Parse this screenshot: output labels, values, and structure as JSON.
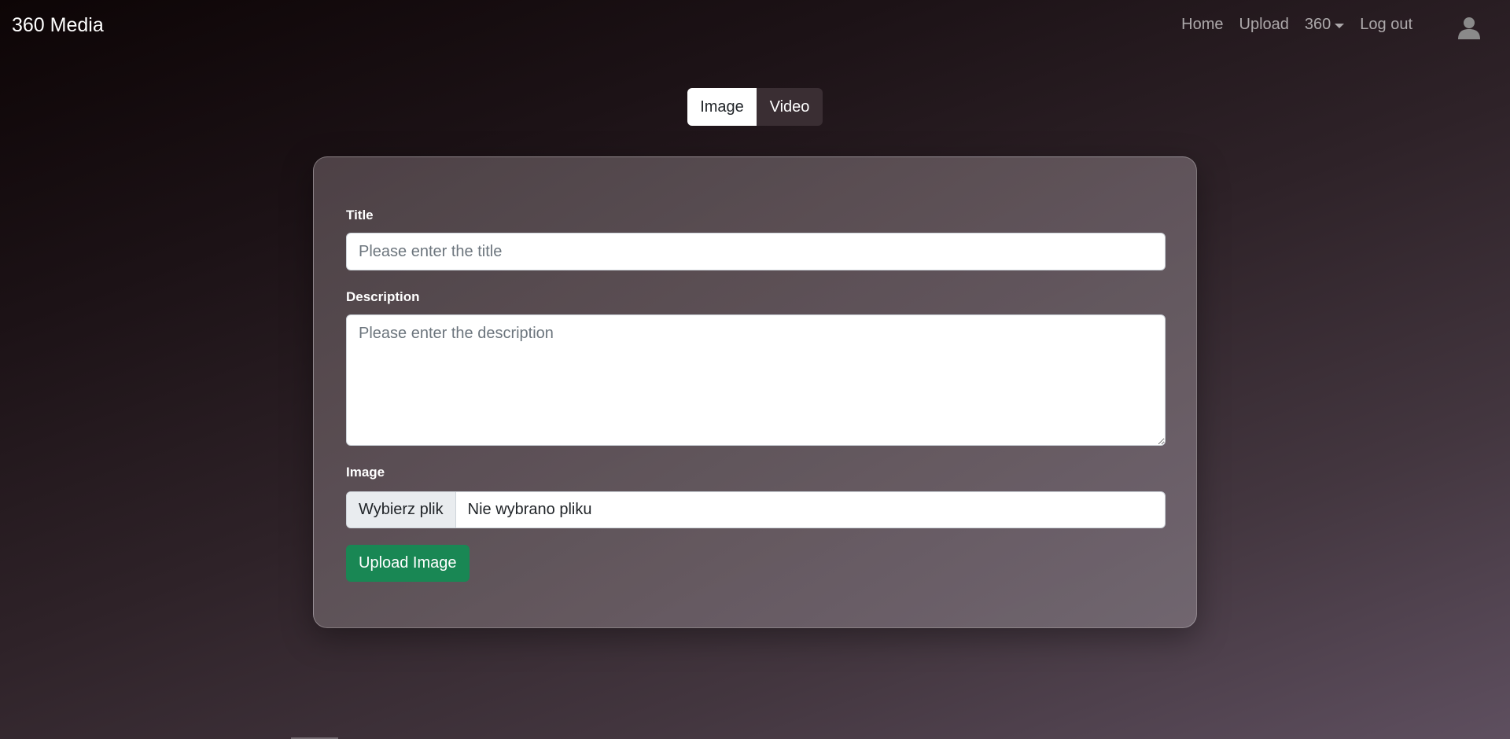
{
  "navbar": {
    "brand": "360 Media",
    "links": {
      "home": "Home",
      "upload": "Upload",
      "dropdown": "360",
      "logout": "Log out"
    }
  },
  "media_toggle": {
    "image": "Image",
    "video": "Video",
    "active": "Image"
  },
  "form": {
    "title_label": "Title",
    "title_placeholder": "Please enter the title",
    "title_value": "",
    "description_label": "Description",
    "description_placeholder": "Please enter the description",
    "description_value": "",
    "image_label": "Image",
    "file_button": "Wybierz plik",
    "file_status": "Nie wybrano pliku",
    "submit": "Upload Image"
  },
  "colors": {
    "submit_button": "#198754",
    "toggle_active": "#ffffff",
    "toggle_inactive": "#3a2e33"
  },
  "icons": {
    "user": "user-icon",
    "dropdown": "caret-down-icon"
  }
}
